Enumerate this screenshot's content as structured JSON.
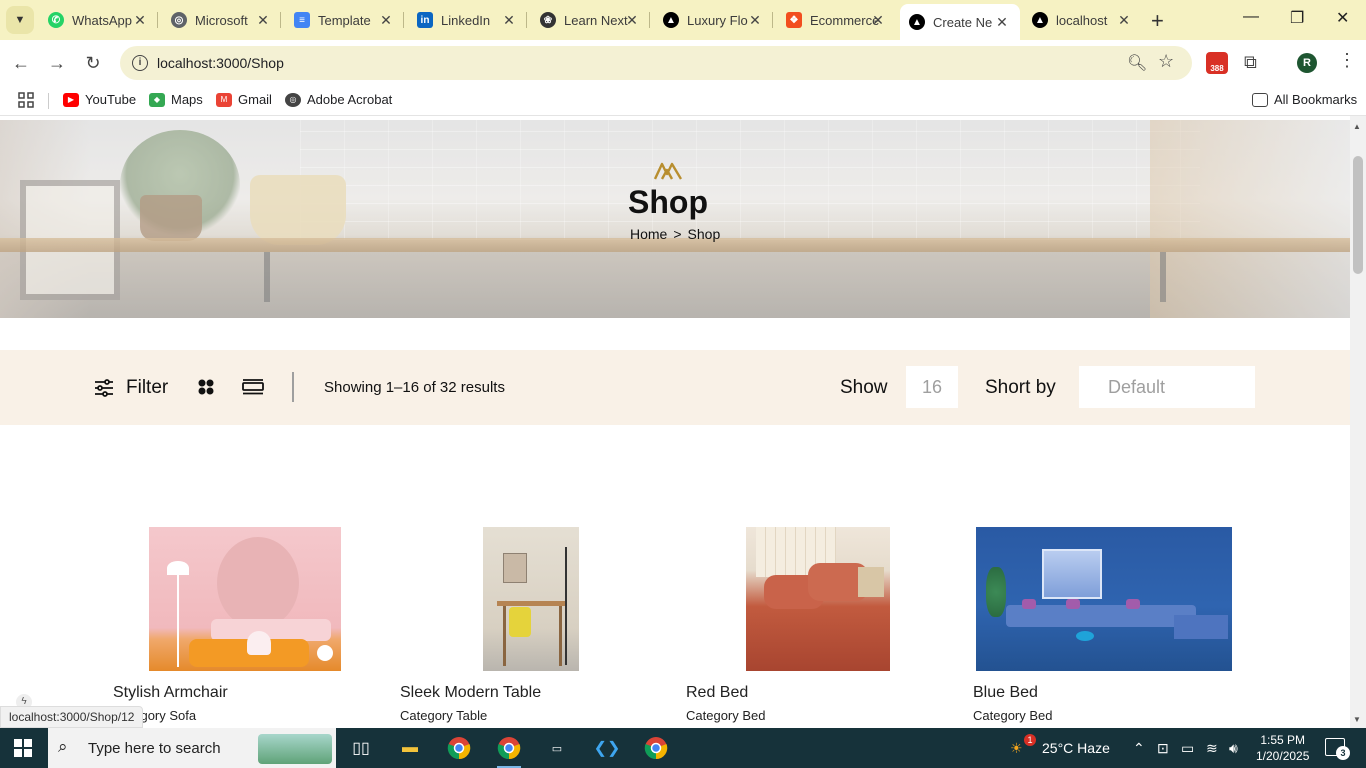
{
  "browser": {
    "tabs": [
      {
        "title": "WhatsApp",
        "icon": "whatsapp-icon",
        "color": "#25d366"
      },
      {
        "title": "Microsoft",
        "icon": "globe-icon",
        "color": "#5f6368"
      },
      {
        "title": "Template",
        "icon": "docs-icon",
        "color": "#4285f4"
      },
      {
        "title": "LinkedIn",
        "icon": "linkedin-icon",
        "color": "#0a66c2"
      },
      {
        "title": "Learn Next",
        "icon": "openai-icon",
        "color": "#333333"
      },
      {
        "title": "Luxury Flo",
        "icon": "vercel-icon",
        "color": "#000000"
      },
      {
        "title": "Ecommerce",
        "icon": "figma-icon",
        "color": "#f24e1e"
      },
      {
        "title": "Create Ne",
        "icon": "vercel-icon",
        "color": "#000000",
        "active": true
      },
      {
        "title": "localhost",
        "icon": "vercel-icon",
        "color": "#000000"
      }
    ],
    "url": "localhost:3000/Shop",
    "extension_badge": "388",
    "profile_initial": "R",
    "bookmarks": [
      {
        "label": "YouTube",
        "color": "#ff0000"
      },
      {
        "label": "Maps",
        "color": "#34a853"
      },
      {
        "label": "Gmail",
        "color": "#ea4335"
      },
      {
        "label": "Adobe Acrobat",
        "color": "#444444"
      }
    ],
    "all_bookmarks": "All Bookmarks",
    "status_url": "localhost:3000/Shop/12"
  },
  "hero": {
    "title": "Shop",
    "breadcrumb": {
      "home": "Home",
      "separator": ">",
      "current": "Shop"
    },
    "logo_color": "#b88e2f"
  },
  "filterbar": {
    "filter_label": "Filter",
    "results_text": "Showing 1–16 of 32 results",
    "show_label": "Show",
    "show_value": "16",
    "sort_label": "Short by",
    "sort_value": "Default",
    "background": "#f9f1e7"
  },
  "products": [
    {
      "name": "Stylish Armchair",
      "category": "Category Sofa"
    },
    {
      "name": "Sleek Modern Table",
      "category": "Category Table"
    },
    {
      "name": "Red Bed",
      "category": "Category Bed"
    },
    {
      "name": "Blue Bed",
      "category": "Category Bed"
    }
  ],
  "taskbar": {
    "search_placeholder": "Type here to search",
    "weather": "25°C  Haze",
    "time": "1:55 PM",
    "date": "1/20/2025",
    "notification_count": "3",
    "weather_alert": "1"
  }
}
